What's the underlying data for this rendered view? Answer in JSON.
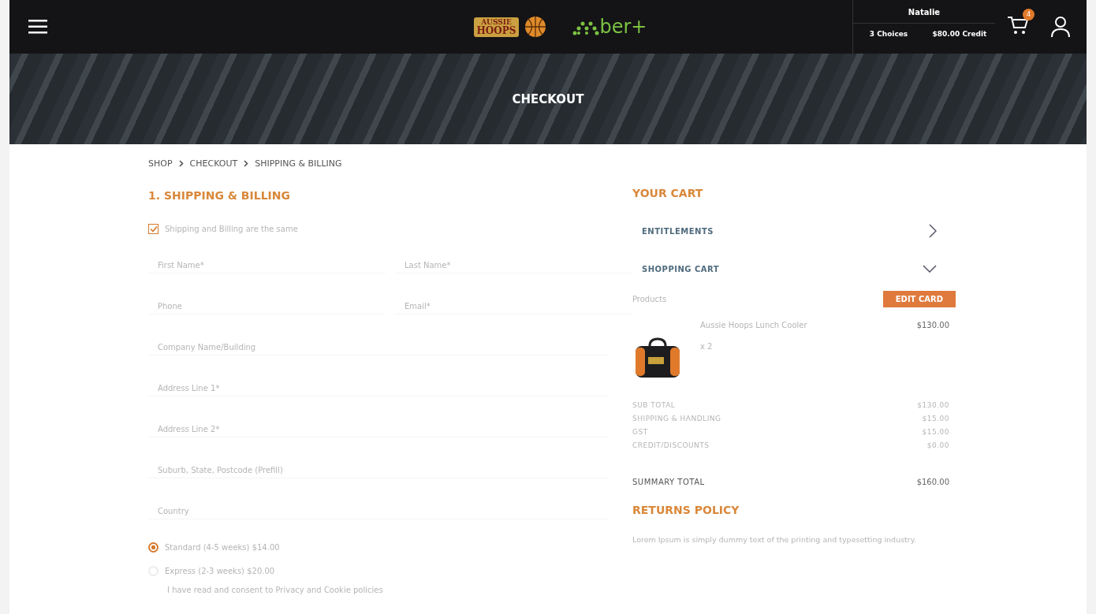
{
  "header": {
    "logo_left": [
      "AUSSIE",
      "HOOPS"
    ],
    "logo_right": {
      "name": "ber+"
    },
    "user": {
      "name": "Natalie",
      "choices": "3 Choices",
      "credit": "$80.00 Credit"
    },
    "cart_count": "4"
  },
  "banner": {
    "title": "CHECKOUT"
  },
  "breadcrumb": [
    "SHOP",
    "CHECKOUT",
    "SHIPPING & BILLING"
  ],
  "shipping": {
    "title": "1. SHIPPING & BILLING",
    "same_address": {
      "label": "Shipping and Billing are the same",
      "checked": true
    },
    "field_rows": [
      [
        {
          "placeholder": "First Name*"
        },
        {
          "placeholder": "Last Name*"
        }
      ],
      [
        {
          "placeholder": "Phone"
        },
        {
          "placeholder": "Email*"
        }
      ],
      [
        {
          "placeholder": "Company Name/Building"
        }
      ],
      [
        {
          "placeholder": "Address Line 1*"
        }
      ],
      [
        {
          "placeholder": "Address Line 2*"
        }
      ],
      [
        {
          "placeholder": "Suburb, State, Postcode (Prefill)"
        }
      ],
      [
        {
          "placeholder": "Country"
        }
      ]
    ],
    "delivery_options": [
      {
        "label": "Standard (4-5 weeks) $14.00",
        "selected": true
      },
      {
        "label": "Express (2-3 weeks) $20.00",
        "selected": false
      }
    ],
    "consent": "I have read and consent to Privacy and Cookie policies"
  },
  "cart": {
    "title": "YOUR CART",
    "sections": [
      {
        "label": "ENTITLEMENTS",
        "expanded": false
      },
      {
        "label": "SHOPPING CART",
        "expanded": true
      }
    ],
    "products_label": "Products",
    "edit_button": "EDIT CARD",
    "items": [
      {
        "name": "Aussie Hoops Lunch Cooler",
        "qty": "x 2",
        "price": "$130.00"
      }
    ],
    "totals": [
      {
        "label": "SUB TOTAL",
        "value": "$130.00"
      },
      {
        "label": "SHIPPING & HANDLING",
        "value": "$15.00"
      },
      {
        "label": "GST",
        "value": "$15.00"
      },
      {
        "label": "CREDIT/DISCOUNTS",
        "value": "$0.00"
      }
    ],
    "summary": {
      "label": "SUMMARY TOTAL",
      "value": "$160.00"
    },
    "returns": {
      "title": "RETURNS POLICY",
      "text": "Lorem Ipsum is simply dummy text of the printing and typesetting industry."
    }
  }
}
